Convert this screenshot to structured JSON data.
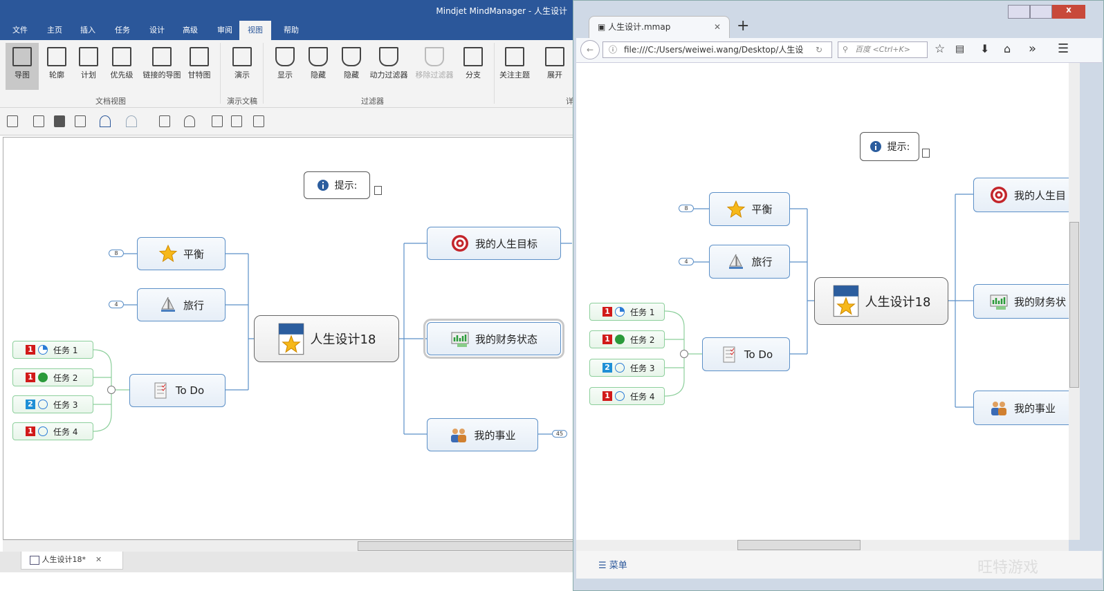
{
  "app": {
    "title": "Mindjet MindManager - 人生设计",
    "menu_tabs": [
      "文件",
      "主页",
      "插入",
      "任务",
      "设计",
      "高级",
      "审阅",
      "视图",
      "帮助"
    ],
    "active_tab": "视图",
    "ribbon": {
      "buttons": [
        {
          "label": "导图",
          "icon": "map-view-icon",
          "selected": true
        },
        {
          "label": "轮廓",
          "icon": "outline-icon"
        },
        {
          "label": "计划",
          "icon": "calendar-24-icon"
        },
        {
          "label": "优先级",
          "icon": "priority-icon"
        },
        {
          "label": "链接的导图",
          "icon": "linked-map-icon"
        },
        {
          "label": "甘特图",
          "icon": "gantt-icon"
        },
        {
          "label": "演示",
          "icon": "presentation-icon"
        },
        {
          "label": "显示",
          "icon": "filter-show-icon"
        },
        {
          "label": "隐藏",
          "icon": "filter-hide-icon"
        },
        {
          "label": "隐藏",
          "icon": "filter-hide-dotted-icon"
        },
        {
          "label": "动力过滤器",
          "icon": "power-filter-icon"
        },
        {
          "label": "移除过滤器",
          "icon": "remove-filter-icon",
          "disabled": true
        },
        {
          "label": "分支",
          "icon": "branch-icon"
        },
        {
          "label": "关注主题",
          "icon": "focus-topic-icon"
        },
        {
          "label": "展开",
          "icon": "expand-icon"
        }
      ],
      "groups": [
        "文档视图",
        "演示文稿",
        "过滤器",
        "详"
      ]
    },
    "doc_tab": "人生设计18*"
  },
  "mindmap": {
    "hint": "提示:",
    "central": "人生设计18",
    "left_topics": [
      {
        "label": "平衡",
        "icon": "star-icon",
        "badge": "8"
      },
      {
        "label": "旅行",
        "icon": "sailboat-icon",
        "badge": "4"
      },
      {
        "label": "To Do",
        "icon": "checklist-icon"
      }
    ],
    "tasks": [
      {
        "label": "任务 1",
        "priority": "1",
        "priority_color": "#d11a1a",
        "progress": "quarter"
      },
      {
        "label": "任务 2",
        "priority": "1",
        "priority_color": "#d11a1a",
        "progress": "done"
      },
      {
        "label": "任务 3",
        "priority": "2",
        "priority_color": "#1f8fd6",
        "progress": "none"
      },
      {
        "label": "任务 4",
        "priority": "1",
        "priority_color": "#d11a1a",
        "progress": "none"
      }
    ],
    "right_topics": [
      {
        "label": "我的人生目标",
        "icon": "target-icon"
      },
      {
        "label": "我的财务状态",
        "icon": "finance-chart-icon"
      },
      {
        "label": "我的事业",
        "icon": "people-icon",
        "badge": "45"
      }
    ],
    "right_topics_browser": [
      "我的人生目",
      "我的财务状",
      "我的事业"
    ]
  },
  "browser": {
    "tab_title": "人生设计.mmap",
    "url": "file:///C:/Users/weiwei.wang/Desktop/人生设",
    "search_placeholder": "百度 <Ctrl+K>",
    "menu_label": "菜单",
    "watermark": "旺特游戏"
  }
}
